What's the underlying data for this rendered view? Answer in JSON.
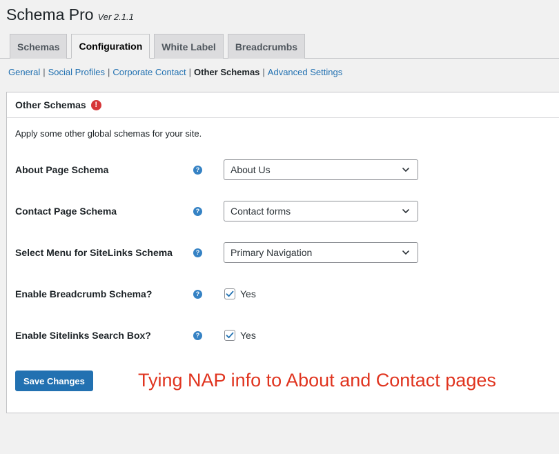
{
  "header": {
    "title": "Schema Pro",
    "version": "Ver 2.1.1"
  },
  "tabs": [
    {
      "label": "Schemas",
      "active": false
    },
    {
      "label": "Configuration",
      "active": true
    },
    {
      "label": "White Label",
      "active": false
    },
    {
      "label": "Breadcrumbs",
      "active": false
    }
  ],
  "subnav": [
    {
      "label": "General"
    },
    {
      "label": "Social Profiles"
    },
    {
      "label": "Corporate Contact"
    },
    {
      "label": "Other Schemas",
      "current": true
    },
    {
      "label": "Advanced Settings"
    }
  ],
  "subnav_separator": "|",
  "panel": {
    "title": "Other Schemas",
    "alert_icon": "!",
    "description": "Apply some other global schemas for your site."
  },
  "fields": [
    {
      "label": "About Page Schema",
      "type": "select",
      "value": "About Us"
    },
    {
      "label": "Contact Page Schema",
      "type": "select",
      "value": "Contact forms"
    },
    {
      "label": "Select Menu for SiteLinks Schema",
      "type": "select",
      "value": "Primary Navigation"
    },
    {
      "label": "Enable Breadcrumb Schema?",
      "type": "checkbox",
      "checked": true,
      "option_label": "Yes"
    },
    {
      "label": "Enable Sitelinks Search Box?",
      "type": "checkbox",
      "checked": true,
      "option_label": "Yes"
    }
  ],
  "help_icon": "?",
  "save_button": "Save Changes",
  "annotation": "Tying NAP info to About and Contact pages",
  "colors": {
    "accent": "#2271b1",
    "annotation": "#e0341f",
    "alert": "#d63638",
    "help": "#3582c4"
  },
  "icons": {
    "help": "question-circle-icon",
    "alert": "exclamation-circle-icon",
    "dropdown": "chevron-down-icon",
    "check": "checkmark-icon"
  }
}
